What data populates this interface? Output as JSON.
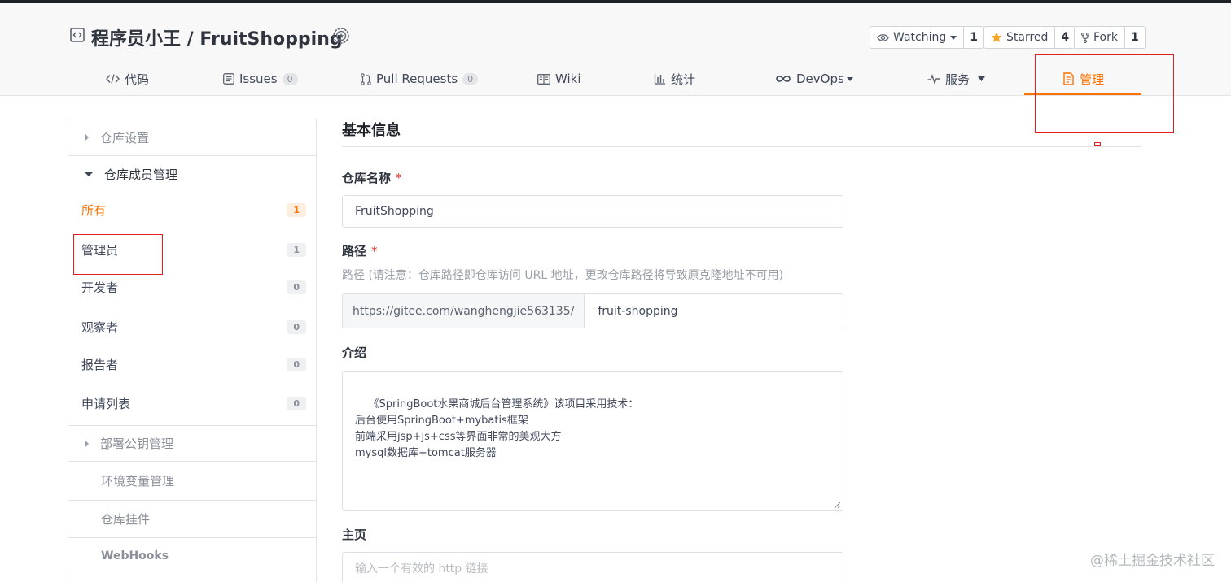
{
  "repo": {
    "title": "程序员小王 / FruitShopping"
  },
  "social": {
    "watching_label": "Watching",
    "watching_count": "1",
    "starred_label": "Starred",
    "starred_count": "4",
    "fork_label": "Fork",
    "fork_count": "1"
  },
  "tabs": {
    "code": "代码",
    "issues": "Issues",
    "issues_count": "0",
    "pulls": "Pull Requests",
    "pulls_count": "0",
    "wiki": "Wiki",
    "stats": "统计",
    "devops": "DevOps",
    "services": "服务",
    "manage": "管理"
  },
  "sidebar": {
    "repo_settings": "仓库设置",
    "members": "仓库成员管理",
    "items": [
      {
        "label": "所有",
        "count": "1"
      },
      {
        "label": "管理员",
        "count": "1"
      },
      {
        "label": "开发者",
        "count": "0"
      },
      {
        "label": "观察者",
        "count": "0"
      },
      {
        "label": "报告者",
        "count": "0"
      },
      {
        "label": "申请列表",
        "count": "0"
      }
    ],
    "deploy_keys": "部署公钥管理",
    "env_vars": "环境变量管理",
    "widgets": "仓库挂件",
    "webhooks": "WebHooks"
  },
  "form": {
    "section_title": "基本信息",
    "name_label": "仓库名称",
    "name_value": "FruitShopping",
    "path_label": "路径",
    "path_hint": "路径 (请注意：仓库路径即仓库访问 URL 地址，更改仓库路径将导致原克隆地址不可用)",
    "path_prefix": "https://gitee.com/wanghengjie563135/",
    "path_value": "fruit-shopping",
    "intro_label": "介绍",
    "intro_value": "《SpringBoot水果商城后台管理系统》该项目采用技术：\n后台使用SpringBoot+mybatis框架\n前端采用jsp+js+css等界面非常的美观大方\nmysql数据库+tomcat服务器",
    "homepage_label": "主页",
    "homepage_placeholder": "输入一个有效的 http 链接"
  },
  "watermark": "@稀土掘金技术社区",
  "colors": {
    "accent": "#fe7300",
    "annotation_red": "#e02020",
    "required": "#e02020"
  }
}
